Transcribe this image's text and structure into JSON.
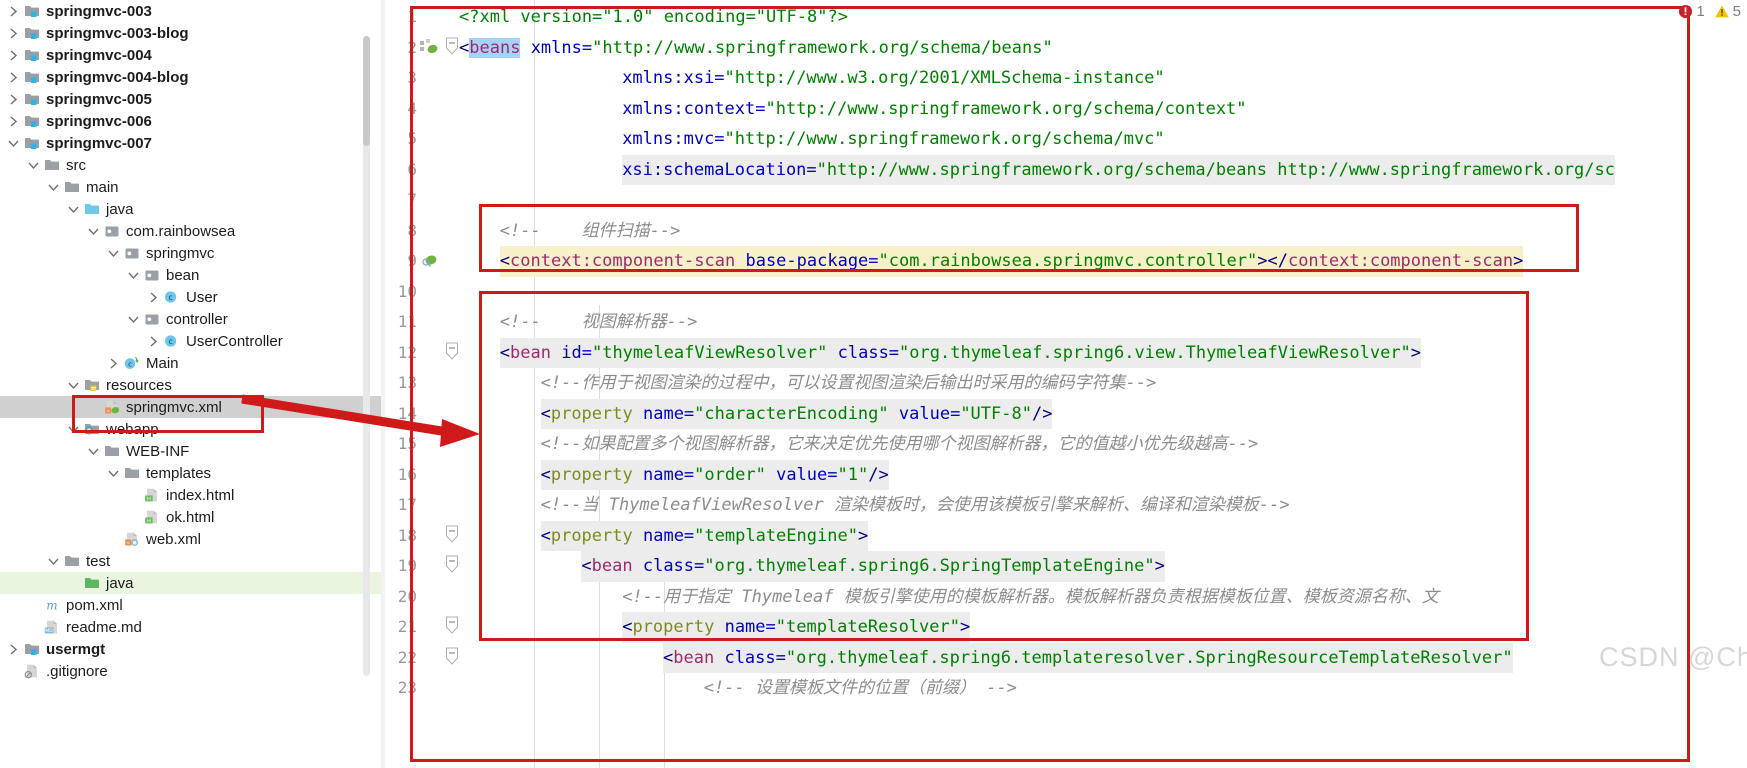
{
  "sidebar": {
    "name": "project-tree",
    "items": [
      {
        "label": "springmvc-003",
        "indent": 0,
        "twisty": "right",
        "icon": "module-folder",
        "bold": true,
        "select": "none"
      },
      {
        "label": "springmvc-003-blog",
        "indent": 0,
        "twisty": "right",
        "icon": "module-folder",
        "bold": true,
        "select": "none"
      },
      {
        "label": "springmvc-004",
        "indent": 0,
        "twisty": "right",
        "icon": "module-folder",
        "bold": true,
        "select": "none"
      },
      {
        "label": "springmvc-004-blog",
        "indent": 0,
        "twisty": "right",
        "icon": "module-folder",
        "bold": true,
        "select": "none"
      },
      {
        "label": "springmvc-005",
        "indent": 0,
        "twisty": "right",
        "icon": "module-folder",
        "bold": true,
        "select": "none"
      },
      {
        "label": "springmvc-006",
        "indent": 0,
        "twisty": "right",
        "icon": "module-folder",
        "bold": true,
        "select": "none"
      },
      {
        "label": "springmvc-007",
        "indent": 0,
        "twisty": "down",
        "icon": "module-folder",
        "bold": true,
        "select": "none"
      },
      {
        "label": "src",
        "indent": 1,
        "twisty": "down",
        "icon": "folder-gray",
        "bold": false,
        "select": "none"
      },
      {
        "label": "main",
        "indent": 2,
        "twisty": "down",
        "icon": "folder-gray",
        "bold": false,
        "select": "none"
      },
      {
        "label": "java",
        "indent": 3,
        "twisty": "down",
        "icon": "folder-blue",
        "bold": false,
        "select": "none"
      },
      {
        "label": "com.rainbowsea",
        "indent": 4,
        "twisty": "down",
        "icon": "package",
        "bold": false,
        "select": "none"
      },
      {
        "label": "springmvc",
        "indent": 5,
        "twisty": "down",
        "icon": "package",
        "bold": false,
        "select": "none"
      },
      {
        "label": "bean",
        "indent": 6,
        "twisty": "down",
        "icon": "package",
        "bold": false,
        "select": "none"
      },
      {
        "label": "User",
        "indent": 7,
        "twisty": "right",
        "icon": "class-public",
        "bold": false,
        "select": "none"
      },
      {
        "label": "controller",
        "indent": 6,
        "twisty": "down",
        "icon": "package",
        "bold": false,
        "select": "none"
      },
      {
        "label": "UserController",
        "indent": 7,
        "twisty": "right",
        "icon": "class-public",
        "bold": false,
        "select": "none"
      },
      {
        "label": "Main",
        "indent": 5,
        "twisty": "right",
        "icon": "class-run",
        "bold": false,
        "select": "none"
      },
      {
        "label": "resources",
        "indent": 3,
        "twisty": "down",
        "icon": "folder-resources",
        "bold": false,
        "select": "none"
      },
      {
        "label": "springmvc.xml",
        "indent": 4,
        "twisty": "none",
        "icon": "xml-spring",
        "bold": false,
        "select": "gray"
      },
      {
        "label": "webapp",
        "indent": 3,
        "twisty": "down",
        "icon": "folder-webapp",
        "bold": false,
        "select": "none"
      },
      {
        "label": "WEB-INF",
        "indent": 4,
        "twisty": "down",
        "icon": "folder-gray",
        "bold": false,
        "select": "none"
      },
      {
        "label": "templates",
        "indent": 5,
        "twisty": "down",
        "icon": "folder-gray",
        "bold": false,
        "select": "none"
      },
      {
        "label": "index.html",
        "indent": 6,
        "twisty": "none",
        "icon": "html-file",
        "bold": false,
        "select": "none"
      },
      {
        "label": "ok.html",
        "indent": 6,
        "twisty": "none",
        "icon": "html-file",
        "bold": false,
        "select": "none"
      },
      {
        "label": "web.xml",
        "indent": 5,
        "twisty": "none",
        "icon": "xml-web",
        "bold": false,
        "select": "none"
      },
      {
        "label": "test",
        "indent": 2,
        "twisty": "down",
        "icon": "folder-gray",
        "bold": false,
        "select": "none"
      },
      {
        "label": "java",
        "indent": 3,
        "twisty": "none",
        "icon": "folder-green",
        "bold": false,
        "select": "green"
      },
      {
        "label": "pom.xml",
        "indent": 1,
        "twisty": "none",
        "icon": "maven",
        "bold": false,
        "select": "none"
      },
      {
        "label": "readme.md",
        "indent": 1,
        "twisty": "none",
        "icon": "md-file",
        "bold": false,
        "select": "none"
      },
      {
        "label": "usermgt",
        "indent": 0,
        "twisty": "right",
        "icon": "module-folder",
        "bold": true,
        "select": "none"
      },
      {
        "label": ".gitignore",
        "indent": 0,
        "twisty": "none",
        "icon": "gitignore-file",
        "bold": false,
        "select": "none"
      }
    ]
  },
  "editor": {
    "name": "xml-editor",
    "inspection": {
      "error_icon": "error-circle-icon",
      "error_count": "1",
      "warning_icon": "warning-triangle-icon",
      "warning_count": "5"
    },
    "watermark": "CSDN @ChinaRainbowsea",
    "lines": [
      {
        "n": "1",
        "indent": 0,
        "highlight": "none",
        "fold": "none",
        "tokens": [
          {
            "c": "t-pi",
            "t": "<?xml version=\"1.0\" encoding=\"UTF-8\"?>"
          }
        ]
      },
      {
        "n": "2",
        "indent": 0,
        "highlight": "none",
        "fold": "collapse",
        "gutter_icon": "spring-bean-icon",
        "tokens": [
          {
            "c": "t-tag",
            "t": "<"
          },
          {
            "c": "t-beans",
            "t": "beans"
          },
          {
            "c": "t-plain",
            "t": " "
          },
          {
            "c": "t-attr",
            "t": "xmlns="
          },
          {
            "c": "t-val",
            "t": "\"http://www.springframework.org/schema/beans\""
          }
        ]
      },
      {
        "n": "3",
        "indent": 4,
        "highlight": "none",
        "fold": "none",
        "tokens": [
          {
            "c": "t-attr",
            "t": "xmlns:xsi="
          },
          {
            "c": "t-val",
            "t": "\"http://www.w3.org/2001/XMLSchema-instance\""
          }
        ]
      },
      {
        "n": "4",
        "indent": 4,
        "highlight": "none",
        "fold": "none",
        "tokens": [
          {
            "c": "t-attr",
            "t": "xmlns:context="
          },
          {
            "c": "t-val",
            "t": "\"http://www.springframework.org/schema/context\""
          }
        ]
      },
      {
        "n": "5",
        "indent": 4,
        "highlight": "none",
        "fold": "none",
        "tokens": [
          {
            "c": "t-attr",
            "t": "xmlns:mvc="
          },
          {
            "c": "t-val",
            "t": "\"http://www.springframework.org/schema/mvc\""
          }
        ]
      },
      {
        "n": "6",
        "indent": 4,
        "highlight": "gray",
        "fold": "none",
        "tokens": [
          {
            "c": "t-attr",
            "t": "xsi:schemaLocation="
          },
          {
            "c": "t-val",
            "t": "\"http://www.springframework.org/schema/beans http://www.springframework.org/sc"
          }
        ]
      },
      {
        "n": "7",
        "indent": 0,
        "highlight": "none",
        "fold": "none",
        "tokens": []
      },
      {
        "n": "8",
        "indent": 1,
        "highlight": "none",
        "fold": "none",
        "tokens": [
          {
            "c": "t-comment",
            "t": "<!--    组件扫描-->"
          }
        ]
      },
      {
        "n": "9",
        "indent": 1,
        "highlight": "yellow",
        "fold": "none",
        "gutter_icon": "spring-scan-icon",
        "tokens": [
          {
            "c": "t-tag",
            "t": "<"
          },
          {
            "c": "t-tagname",
            "t": "context:component-scan"
          },
          {
            "c": "t-plain",
            "t": " "
          },
          {
            "c": "t-attr",
            "t": "base-package="
          },
          {
            "c": "t-val",
            "t": "\"com.rainbowsea.springmvc.controller\""
          },
          {
            "c": "t-tag",
            "t": "></"
          },
          {
            "c": "t-tagname",
            "t": "context:component-scan"
          },
          {
            "c": "t-tag",
            "t": ">"
          }
        ]
      },
      {
        "n": "10",
        "indent": 0,
        "highlight": "none",
        "fold": "none",
        "tokens": []
      },
      {
        "n": "11",
        "indent": 1,
        "highlight": "none",
        "fold": "none",
        "tokens": [
          {
            "c": "t-comment",
            "t": "<!--    视图解析器-->"
          }
        ]
      },
      {
        "n": "12",
        "indent": 1,
        "highlight": "gray",
        "fold": "collapse",
        "tokens": [
          {
            "c": "t-tag",
            "t": "<"
          },
          {
            "c": "t-tagname",
            "t": "bean"
          },
          {
            "c": "t-plain",
            "t": " "
          },
          {
            "c": "t-attr",
            "t": "id="
          },
          {
            "c": "t-val",
            "t": "\"thymeleafViewResolver\""
          },
          {
            "c": "t-plain",
            "t": " "
          },
          {
            "c": "t-attr",
            "t": "class="
          },
          {
            "c": "t-val",
            "t": "\"org.thymeleaf.spring6.view.ThymeleafViewResolver\""
          },
          {
            "c": "t-tag",
            "t": ">"
          }
        ]
      },
      {
        "n": "13",
        "indent": 2,
        "highlight": "none",
        "fold": "none",
        "tokens": [
          {
            "c": "t-comment",
            "t": "<!--作用于视图渲染的过程中，可以设置视图渲染后输出时采用的编码字符集-->"
          }
        ]
      },
      {
        "n": "14",
        "indent": 2,
        "highlight": "gray",
        "fold": "none",
        "tokens": [
          {
            "c": "t-tag",
            "t": "<"
          },
          {
            "c": "t-prop",
            "t": "property"
          },
          {
            "c": "t-plain",
            "t": " "
          },
          {
            "c": "t-attr",
            "t": "name="
          },
          {
            "c": "t-val",
            "t": "\"characterEncoding\""
          },
          {
            "c": "t-plain",
            "t": " "
          },
          {
            "c": "t-attr",
            "t": "value="
          },
          {
            "c": "t-val",
            "t": "\"UTF-8\""
          },
          {
            "c": "t-tag",
            "t": "/>"
          }
        ]
      },
      {
        "n": "15",
        "indent": 2,
        "highlight": "none",
        "fold": "none",
        "tokens": [
          {
            "c": "t-comment",
            "t": "<!--如果配置多个视图解析器，它来决定优先使用哪个视图解析器，它的值越小优先级越高-->"
          }
        ]
      },
      {
        "n": "16",
        "indent": 2,
        "highlight": "gray",
        "fold": "none",
        "tokens": [
          {
            "c": "t-tag",
            "t": "<"
          },
          {
            "c": "t-prop",
            "t": "property"
          },
          {
            "c": "t-plain",
            "t": " "
          },
          {
            "c": "t-attr",
            "t": "name="
          },
          {
            "c": "t-val",
            "t": "\"order\""
          },
          {
            "c": "t-plain",
            "t": " "
          },
          {
            "c": "t-attr",
            "t": "value="
          },
          {
            "c": "t-val",
            "t": "\"1\""
          },
          {
            "c": "t-tag",
            "t": "/>"
          }
        ]
      },
      {
        "n": "17",
        "indent": 2,
        "highlight": "none",
        "fold": "none",
        "tokens": [
          {
            "c": "t-comment",
            "t": "<!--当 ThymeleafViewResolver 渲染模板时，会使用该模板引擎来解析、编译和渲染模板-->"
          }
        ]
      },
      {
        "n": "18",
        "indent": 2,
        "highlight": "gray",
        "fold": "collapse",
        "tokens": [
          {
            "c": "t-tag",
            "t": "<"
          },
          {
            "c": "t-prop",
            "t": "property"
          },
          {
            "c": "t-plain",
            "t": " "
          },
          {
            "c": "t-attr",
            "t": "name="
          },
          {
            "c": "t-val",
            "t": "\"templateEngine\""
          },
          {
            "c": "t-tag",
            "t": ">"
          }
        ]
      },
      {
        "n": "19",
        "indent": 3,
        "highlight": "gray",
        "fold": "collapse",
        "tokens": [
          {
            "c": "t-tag",
            "t": "<"
          },
          {
            "c": "t-tagname",
            "t": "bean"
          },
          {
            "c": "t-plain",
            "t": " "
          },
          {
            "c": "t-attr",
            "t": "class="
          },
          {
            "c": "t-val",
            "t": "\"org.thymeleaf.spring6.SpringTemplateEngine\""
          },
          {
            "c": "t-tag",
            "t": ">"
          }
        ]
      },
      {
        "n": "20",
        "indent": 4,
        "highlight": "none",
        "fold": "none",
        "tokens": [
          {
            "c": "t-comment",
            "t": "<!--用于指定 Thymeleaf 模板引擎使用的模板解析器。模板解析器负责根据模板位置、模板资源名称、文"
          }
        ]
      },
      {
        "n": "21",
        "indent": 4,
        "highlight": "gray",
        "fold": "collapse",
        "tokens": [
          {
            "c": "t-tag",
            "t": "<"
          },
          {
            "c": "t-prop",
            "t": "property"
          },
          {
            "c": "t-plain",
            "t": " "
          },
          {
            "c": "t-attr",
            "t": "name="
          },
          {
            "c": "t-val",
            "t": "\"templateResolver\""
          },
          {
            "c": "t-tag",
            "t": ">"
          }
        ]
      },
      {
        "n": "22",
        "indent": 5,
        "highlight": "gray",
        "fold": "collapse",
        "tokens": [
          {
            "c": "t-tag",
            "t": "<"
          },
          {
            "c": "t-tagname",
            "t": "bean"
          },
          {
            "c": "t-plain",
            "t": " "
          },
          {
            "c": "t-attr",
            "t": "class="
          },
          {
            "c": "t-val",
            "t": "\"org.thymeleaf.spring6.templateresolver.SpringResourceTemplateResolver\""
          }
        ]
      },
      {
        "n": "23",
        "indent": 6,
        "highlight": "none",
        "fold": "none",
        "tokens": [
          {
            "c": "t-comment",
            "t": "<!-- 设置模板文件的位置（前缀） -->"
          }
        ]
      }
    ]
  },
  "annotations": {
    "box_color": "#d01a1a",
    "file_box_name": "springmvc-xml-highlight-box",
    "code_box_1_name": "component-scan-highlight-box",
    "code_box_2_name": "view-resolver-highlight-box",
    "outer_box_name": "editor-outline-box",
    "arrow_name": "pointer-arrow"
  }
}
